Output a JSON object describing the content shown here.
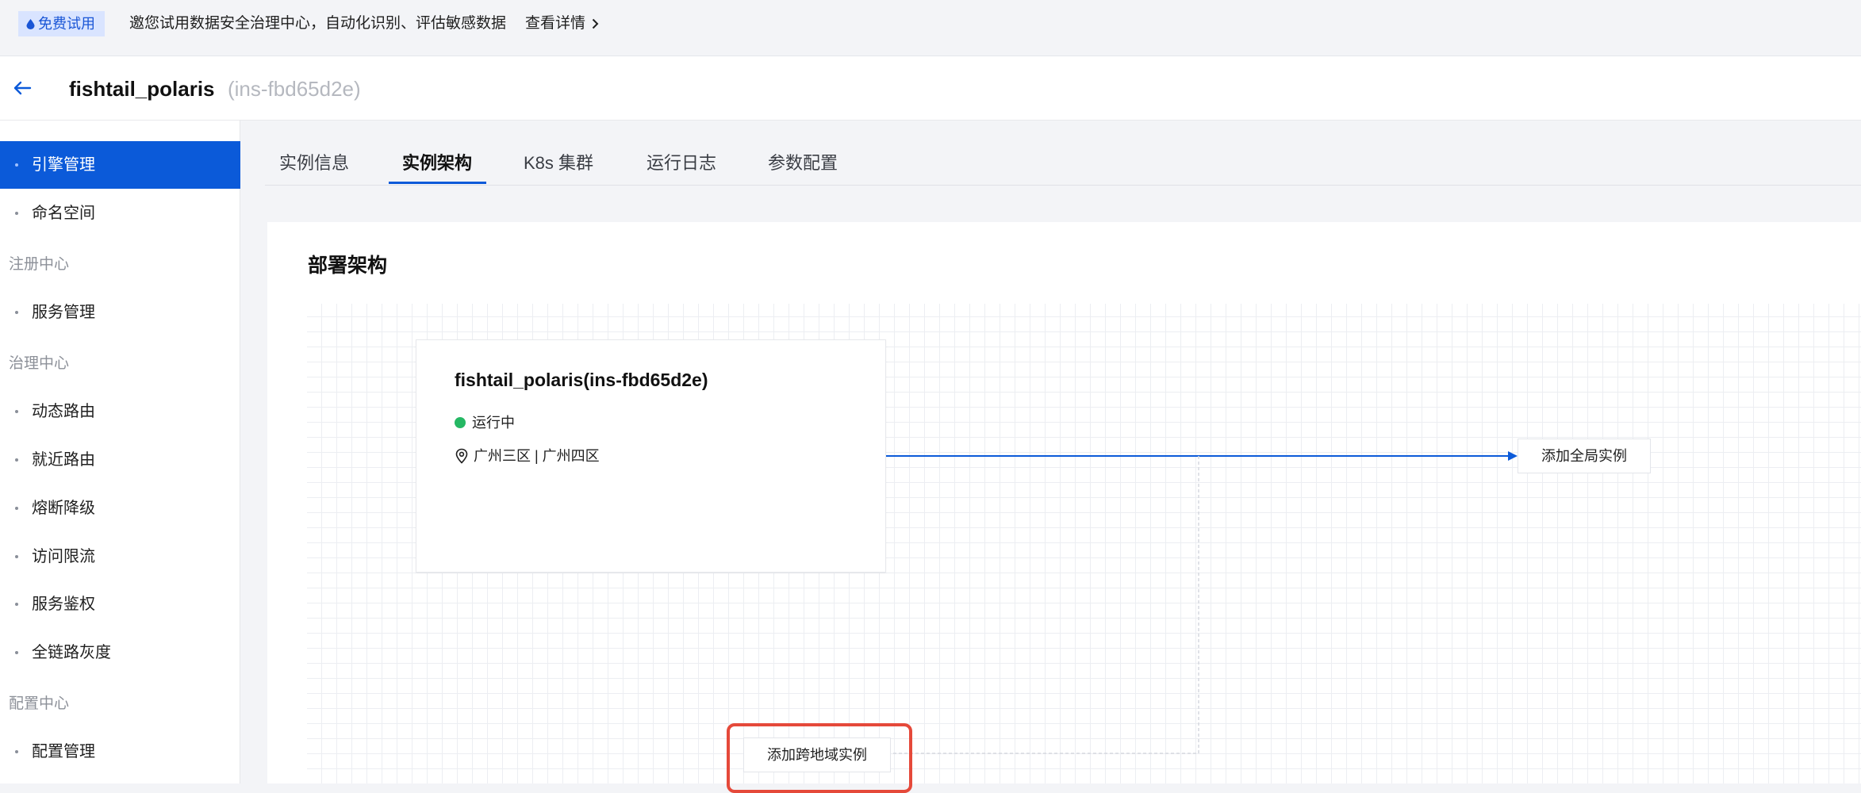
{
  "promo": {
    "badge": "免费试用",
    "text": "邀您试用数据安全治理中心，自动化识别、评估敏感数据",
    "link": "查看详情"
  },
  "header": {
    "title": "fishtail_polaris",
    "instance_id": "(ins-fbd65d2e)"
  },
  "sidebar": {
    "items": [
      {
        "label": "引擎管理",
        "active": true
      },
      {
        "label": "命名空间"
      },
      {
        "group": "注册中心"
      },
      {
        "label": "服务管理"
      },
      {
        "group": "治理中心"
      },
      {
        "label": "动态路由"
      },
      {
        "label": "就近路由"
      },
      {
        "label": "熔断降级"
      },
      {
        "label": "访问限流"
      },
      {
        "label": "服务鉴权"
      },
      {
        "label": "全链路灰度"
      },
      {
        "group": "配置中心"
      },
      {
        "label": "配置管理"
      }
    ]
  },
  "tabs": [
    {
      "label": "实例信息"
    },
    {
      "label": "实例架构",
      "active": true
    },
    {
      "label": "K8s 集群"
    },
    {
      "label": "运行日志"
    },
    {
      "label": "参数配置"
    }
  ],
  "section": {
    "title": "部署架构"
  },
  "instance_node": {
    "title": "fishtail_polaris(ins-fbd65d2e)",
    "status": "运行中",
    "status_color": "#25b864",
    "region": "广州三区 | 广州四区"
  },
  "actions": {
    "add_global": "添加全局实例",
    "add_cross_region": "添加跨地域实例"
  },
  "colors": {
    "accent": "#0b5ad9",
    "highlight": "#e5493a"
  }
}
